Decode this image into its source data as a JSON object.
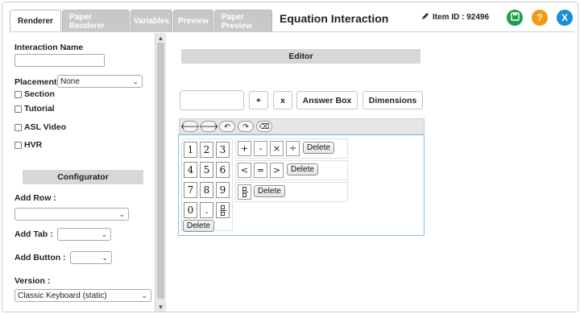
{
  "tabs": [
    {
      "label": "Renderer",
      "active": true
    },
    {
      "label": "Paper Renderer",
      "active": false
    },
    {
      "label": "Variables",
      "active": false
    },
    {
      "label": "Preview",
      "active": false
    },
    {
      "label": "Paper Preview",
      "active": false
    }
  ],
  "header": {
    "title": "Equation Interaction",
    "item_id_label": "Item ID : 92496"
  },
  "colors": {
    "save": "#1e9e4a",
    "help": "#f39a14",
    "close": "#1a8fd6",
    "keyboard_border": "#7fc1e3"
  },
  "left_panel": {
    "interaction_name_label": "Interaction Name",
    "interaction_name_value": "",
    "placement_label": "Placement",
    "placement_value": "None",
    "checkboxes": [
      {
        "label": "Section",
        "checked": false
      },
      {
        "label": "Tutorial",
        "checked": false
      },
      {
        "label": "ASL Video",
        "checked": false
      },
      {
        "label": "HVR",
        "checked": false
      }
    ],
    "configurator_title": "Configurator",
    "add_row_label": "Add Row :",
    "add_row_value": "",
    "add_tab_label": "Add Tab :",
    "add_tab_value": "",
    "add_button_label": "Add Button :",
    "add_button_value": "",
    "version_label": "Version :",
    "version_value": "Classic Keyboard (static)"
  },
  "editor": {
    "title": "Editor",
    "answer_value": "",
    "buttons": {
      "plus": "+",
      "times": "x",
      "answer_box": "Answer Box",
      "dimensions": "Dimensions"
    },
    "nav_icons": [
      "arrow-left-icon",
      "arrow-right-icon",
      "undo-icon",
      "redo-icon",
      "backspace-icon"
    ],
    "nav_glyphs": [
      "🡐",
      "🡒",
      "↶",
      "↷",
      "⌫"
    ]
  },
  "keyboard": {
    "numpad": [
      "1",
      "2",
      "3",
      "4",
      "5",
      "6",
      "7",
      "8",
      "9",
      "0",
      "."
    ],
    "numpad_delete": "Delete",
    "row1": [
      "+",
      "-",
      "×",
      "÷"
    ],
    "row1_delete": "Delete",
    "row2": [
      "<",
      "=",
      ">"
    ],
    "row2_delete": "Delete",
    "row3_delete": "Delete"
  }
}
